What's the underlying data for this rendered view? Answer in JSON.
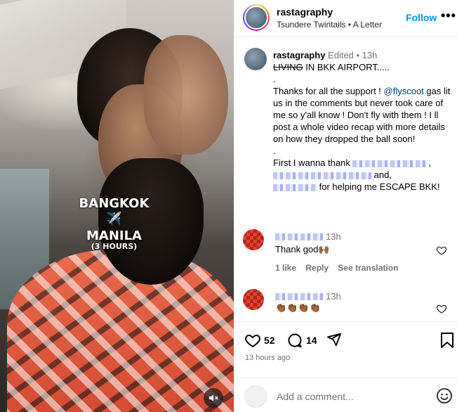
{
  "video": {
    "overlay_line1": "BANGKOK",
    "overlay_plane": "✈️",
    "overlay_line2": "MANILA",
    "overlay_line3": "(3 HOURS)"
  },
  "header": {
    "username": "rastagraphy",
    "audio": "Tsundere Twintails • A Letter",
    "follow_label": "Follow",
    "more_label": "•••"
  },
  "caption": {
    "username": "rastagraphy",
    "edited": "Edited",
    "time": "13h",
    "strike_word": "LIVING",
    "line1_rest": " IN BKK AIRPORT.....",
    "dot1": ".",
    "para1_start": "Thanks for all the support ! ",
    "mention": "@flyscoot",
    "para1_rest": " gas lit us in the comments but never took care of me so y'all know ! Don't fly with them ! I ll post a whole video recap with more details on how they dropped the ball soon!",
    "dot2": ".",
    "thanks_start": "First I wanna thank ",
    "comma1": ",",
    "and_text": " and,",
    "escape_text": " for helping me ESCAPE BKK!"
  },
  "comments": [
    {
      "time": "13h",
      "text": "Thank god🙌🏾",
      "likes": "1 like",
      "reply": "Reply",
      "translation": "See translation"
    },
    {
      "time": "13h",
      "text": "👏🏾👏🏾👏🏾👏🏾"
    }
  ],
  "actions": {
    "likes_count": "52",
    "comments_count": "14"
  },
  "timestamp": "13 hours ago",
  "add_comment": {
    "placeholder": "Add a comment..."
  }
}
